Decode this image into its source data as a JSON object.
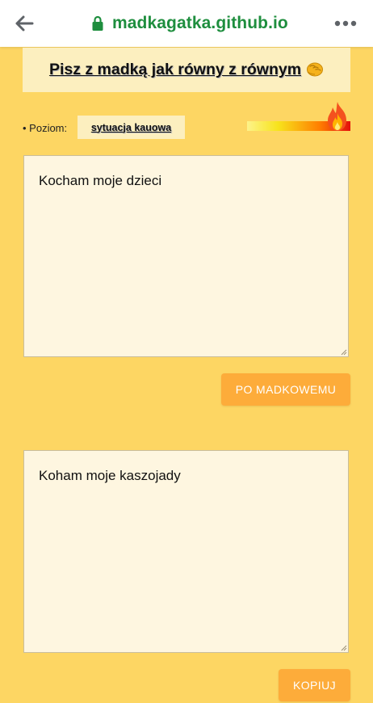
{
  "browser": {
    "url": "madkagatka.github.io",
    "back_icon": "arrow-left-icon",
    "lock_icon": "lock-icon",
    "menu_icon": "more-horizontal-icon",
    "url_color": "#1e8e3e"
  },
  "header": {
    "title": "Pisz z madką jak równy z równym",
    "title_emoji_icon": "fist-bump-icon"
  },
  "level": {
    "label": "• Poziom:",
    "value": "sytuacja kauowa",
    "heat_icon": "fire-icon",
    "heat_level": 1.0
  },
  "input": {
    "text": "Kocham moje dzieci"
  },
  "translate_button": {
    "label": "PO MADKOWEMU"
  },
  "output": {
    "text": "Koham moje kaszojady"
  },
  "copy_button": {
    "label": "KOPIUJ"
  },
  "colors": {
    "page_background": "#fdd663",
    "panel_background": "#fef6e0",
    "title_background": "#fcefbf",
    "button_background": "#fdac3a",
    "button_text": "#ffffff"
  }
}
